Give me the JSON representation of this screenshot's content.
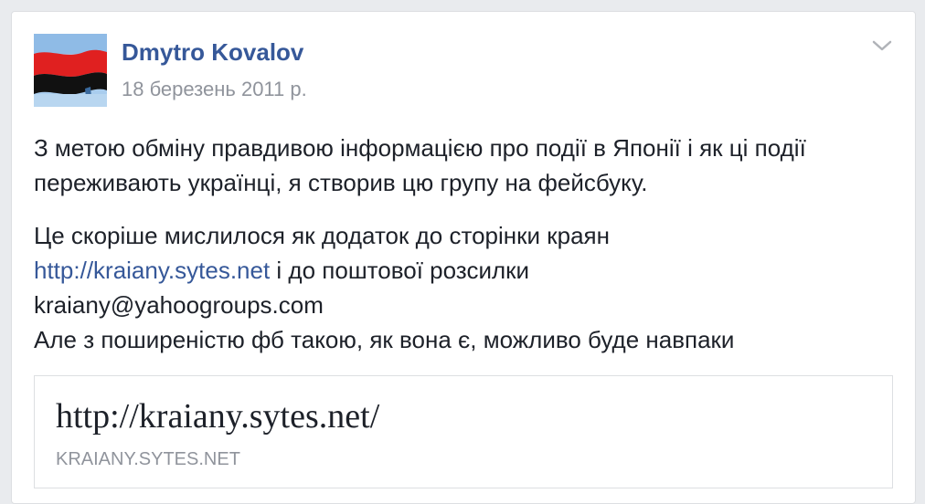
{
  "post": {
    "author": "Dmytro Kovalov",
    "date": "18 березень 2011 р.",
    "avatar_icon": "flag-red-black-icon",
    "menu_icon": "chevron-down-icon",
    "paragraph1": "З метою обміну правдивою інформацією про події в Японії і як ці події переживають українці, я створив цю групу на фейсбуку.",
    "paragraph2_line1": "Це скоріше мислилося як додаток до сторінки краян",
    "paragraph2_link": "http://kraiany.sytes.net",
    "paragraph2_after_link": " і до поштової розсилки",
    "paragraph2_line3": "kraiany@yahoogroups.com",
    "paragraph3": "Але з поширеністю фб такою, як вона є, можливо буде навпаки"
  },
  "link_preview": {
    "title": "http://kraiany.sytes.net/",
    "domain": "KRAIANY.SYTES.NET"
  },
  "colors": {
    "link": "#365899",
    "text": "#1d2129",
    "muted": "#90949c",
    "flag_red": "#e02020",
    "flag_black": "#111111"
  }
}
